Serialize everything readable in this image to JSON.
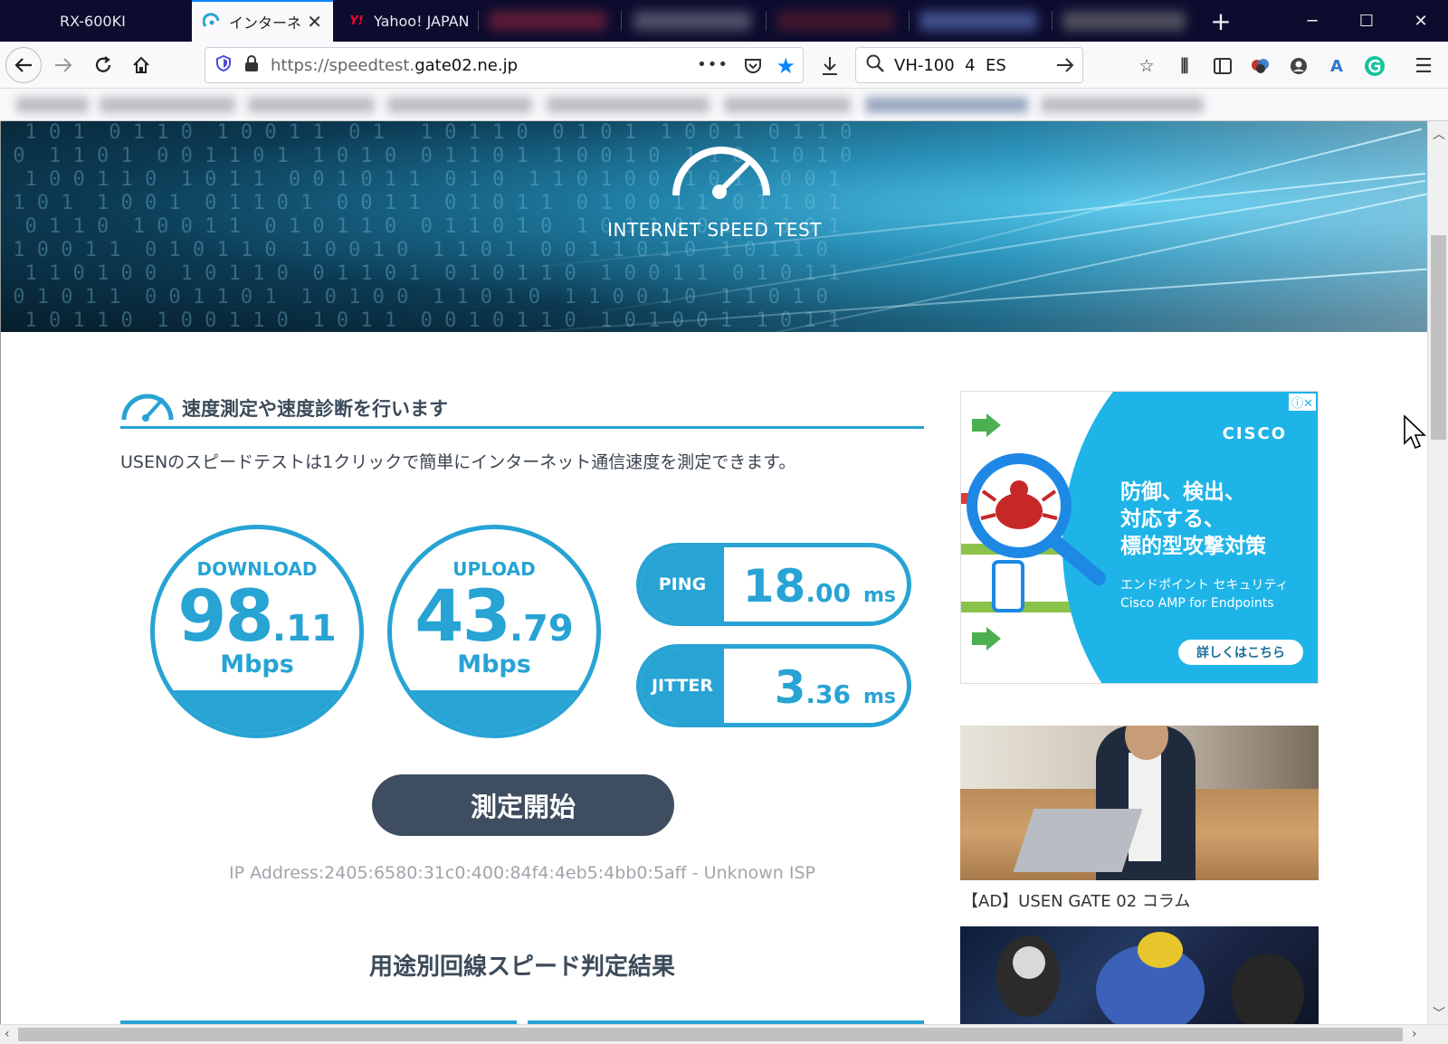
{
  "browser": {
    "tabs": [
      {
        "label": "RX-600KI"
      },
      {
        "label": "インターネット",
        "active": true
      },
      {
        "label": "Yahoo! JAPAN"
      }
    ],
    "favicon_yahoo": "Y!",
    "url_prefix": "https://speedtest.",
    "url_domain": "gate02.ne.jp",
    "search_value": "VH-100  4  ES",
    "window_controls": [
      "minimize",
      "maximize",
      "close"
    ]
  },
  "hero": {
    "title": "INTERNET SPEED TEST"
  },
  "section": {
    "title": "速度測定や速度診断を行います",
    "description": "USENのスピードテストは1クリックで簡単にインターネット通信速度を測定できます。"
  },
  "download": {
    "label": "DOWNLOAD",
    "int": "98",
    "dec": ".11",
    "unit": "Mbps"
  },
  "upload": {
    "label": "UPLOAD",
    "int": "43",
    "dec": ".79",
    "unit": "Mbps"
  },
  "ping": {
    "label": "PING",
    "int": "18",
    "dec": ".00",
    "unit": "ms"
  },
  "jitter": {
    "label": "JITTER",
    "int": "3",
    "dec": ".36",
    "unit": "ms"
  },
  "start_button": "測定開始",
  "ip_line": "IP Address:2405:6580:31c0:400:84f4:4eb5:4bb0:5aff - Unknown ISP",
  "results_title": "用途別回線スピード判定結果",
  "ads": {
    "cisco": {
      "brand": "CISCO",
      "headline": "防御、検出、\n対応する、\n標的型攻撃対策",
      "sub": "エンドポイント セキュリティ\nCisco AMP for Endpoints",
      "button": "詳しくはこちら"
    },
    "photo_caption": "【AD】USEN GATE 02 コラム"
  },
  "colors": {
    "accent": "#27a3d4",
    "button": "#3e4d5f",
    "tabbar": "#0c0c2e"
  },
  "icons": {
    "back": "arrow-left-icon",
    "forward": "arrow-right-icon",
    "reload": "reload-icon",
    "home": "home-icon",
    "shield": "shield-icon",
    "lock": "lock-icon",
    "more": "more-icon",
    "pocket": "pocket-icon",
    "bookmark": "star-icon",
    "download": "download-icon",
    "search": "search-icon",
    "go": "arrow-right-icon",
    "menu": "hamburger-icon"
  }
}
